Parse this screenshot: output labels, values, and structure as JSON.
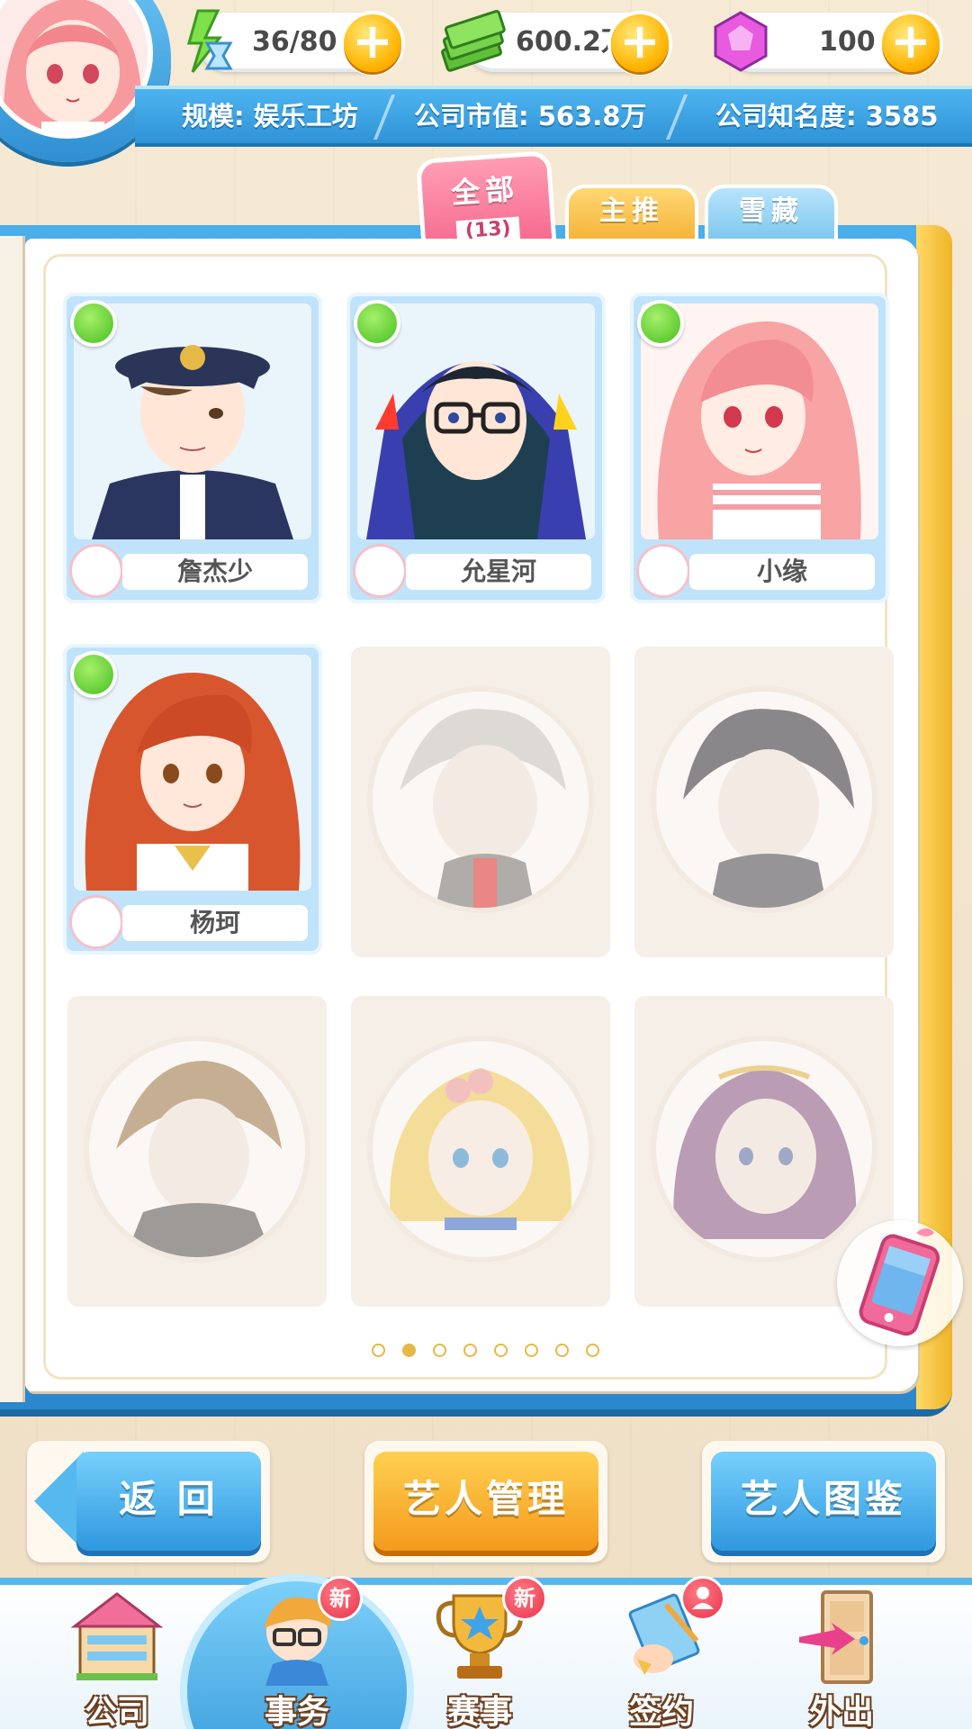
{
  "resources": {
    "energy": "36/80",
    "cash": "600.2万",
    "gems": "100"
  },
  "stats": {
    "scale": "规模: 娱乐工坊",
    "market_value": "公司市值: 563.8万",
    "fame": "公司知名度: 3585"
  },
  "tabs": {
    "all_label": "全部",
    "all_count": "(13)",
    "main_label": "主推",
    "snow_label": "雪藏"
  },
  "artists": [
    {
      "name": "詹杰少",
      "status": "happy"
    },
    {
      "name": "允星河",
      "status": "happy"
    },
    {
      "name": "小缘",
      "status": "happy"
    },
    {
      "name": "杨珂",
      "status": "happy"
    }
  ],
  "pagination": {
    "total": 8,
    "current": 2
  },
  "buttons": {
    "back": "返 回",
    "manage": "艺人管理",
    "gallery": "艺人图鉴"
  },
  "nav": {
    "company": "公司",
    "affairs": "事务",
    "contest": "赛事",
    "sign": "签约",
    "outing": "外出",
    "new_badge": "新"
  },
  "colors": {
    "accent_blue": "#2f93d6",
    "accent_orange": "#f49a1c",
    "tab_pink": "#f66a8f"
  }
}
